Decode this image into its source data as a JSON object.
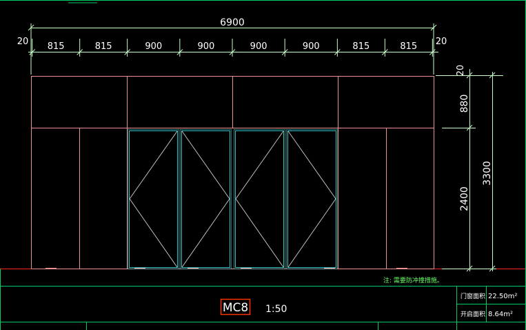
{
  "drawing": {
    "dimensions": {
      "total_width": "6900",
      "edge_left": "20",
      "edge_right": "20",
      "panel_widths": [
        "815",
        "815",
        "900",
        "900",
        "900",
        "900",
        "815",
        "815"
      ],
      "top_offset": "20",
      "transom_height": "880",
      "door_height": "2400",
      "total_height": "3300"
    },
    "note": "注: 需要防冲撞措施。",
    "title": {
      "code": "MC8",
      "scale": "1:50"
    },
    "info_table": [
      {
        "label": "门窗面积",
        "value": "22.50m²"
      },
      {
        "label": "开启面积",
        "value": "8.64m²"
      }
    ]
  },
  "colors": {
    "background": "#000000",
    "frame": "#f09090",
    "door_leaf": "#30c0c0",
    "dimension": "#c8ffc8",
    "dimension_text": "#ffffff",
    "border": "#00ff66",
    "title_box": "#ff3300"
  }
}
